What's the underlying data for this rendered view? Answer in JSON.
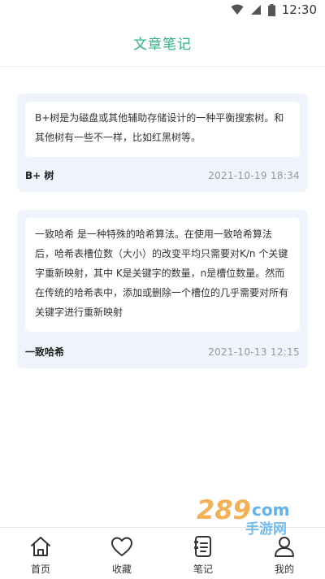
{
  "status_bar": {
    "time": "12:30"
  },
  "header": {
    "title": "文章笔记"
  },
  "notes": [
    {
      "excerpt": "B+树是为磁盘或其他辅助存储设计的一种平衡搜索树。和其他树有一些不一样，比如红黑树等。",
      "name": "B+ 树",
      "date": "2021-10-19 18:34"
    },
    {
      "excerpt": "一致哈希 是一种特殊的哈希算法。在使用一致哈希算法后，哈希表槽位数（大小）的改变平均只需要对K/n 个关键字重新映射，其中 K是关键字的数量，n是槽位数量。然而在传统的哈希表中，添加或删除一个槽位的几乎需要对所有关键字进行重新映射",
      "name": "一致哈希",
      "date": "2021-10-13 12:15"
    }
  ],
  "tabs": [
    {
      "label": "首页",
      "icon": "home-icon"
    },
    {
      "label": "收藏",
      "icon": "heart-icon"
    },
    {
      "label": "笔记",
      "icon": "notebook-icon"
    },
    {
      "label": "我的",
      "icon": "person-icon"
    }
  ],
  "watermark": {
    "brand": "289",
    "suffix": "com",
    "text": "手游网"
  },
  "colors": {
    "accent": "#2fb28a",
    "card_bg": "#eef3fc"
  }
}
